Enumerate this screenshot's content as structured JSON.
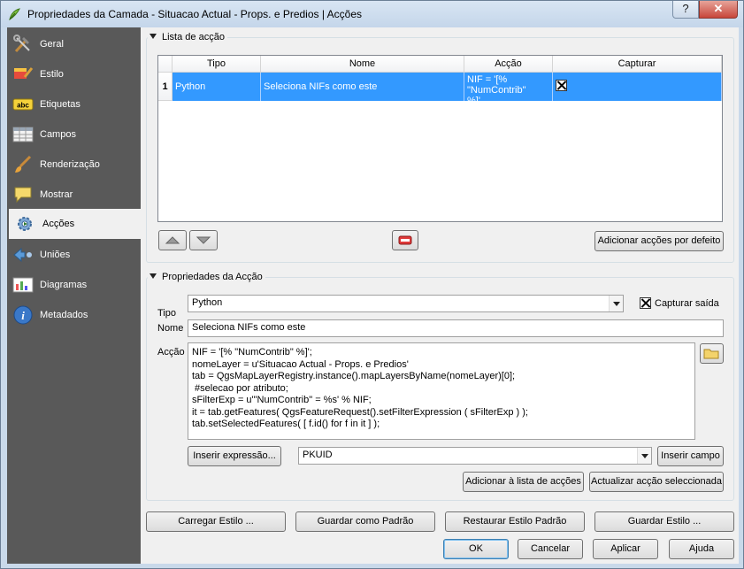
{
  "window": {
    "title": "Propriedades da Camada - Situacao Actual - Props. e Predios | Acções",
    "help": "?",
    "close": "✕"
  },
  "sidebar": {
    "items": [
      {
        "label": "Geral"
      },
      {
        "label": "Estilo"
      },
      {
        "label": "Etiquetas"
      },
      {
        "label": "Campos"
      },
      {
        "label": "Renderização"
      },
      {
        "label": "Mostrar"
      },
      {
        "label": "Acções"
      },
      {
        "label": "Uniões"
      },
      {
        "label": "Diagramas"
      },
      {
        "label": "Metadados"
      }
    ]
  },
  "actions_list": {
    "title": "Lista de acção",
    "columns": [
      "Tipo",
      "Nome",
      "Acção",
      "Capturar"
    ],
    "rows": [
      {
        "index": "1",
        "tipo": "Python",
        "nome": "Seleciona NIFs como este",
        "accao": "NIF = '[% \"NumContrib\" %]'...",
        "capturar": true
      }
    ],
    "default_button": "Adicionar acções por defeito"
  },
  "properties": {
    "title": "Propriedades da Acção",
    "tipo_label": "Tipo",
    "tipo_value": "Python",
    "capture_label": "Capturar saída",
    "capture_checked": true,
    "nome_label": "Nome",
    "nome_value": "Seleciona NIFs como este",
    "accao_label": "Acção",
    "code": "NIF = '[% \"NumContrib\" %]';\nnomeLayer = u'Situacao Actual - Props. e Predios'\ntab = QgsMapLayerRegistry.instance().mapLayersByName(nomeLayer)[0];\n #selecao por atributo;\nsFilterExp = u'\"NumContrib\" = %s' % NIF;\nit = tab.getFeatures( QgsFeatureRequest().setFilterExpression ( sFilterExp ) );\ntab.setSelectedFeatures( [ f.id() for f in it ] );",
    "insert_expression": "Inserir expressão...",
    "field_value": "PKUID",
    "insert_field": "Inserir campo",
    "add_to_list": "Adicionar à lista de acções",
    "update_selected": "Actualizar acção seleccionada"
  },
  "style_buttons": {
    "load": "Carregar Estilo ...",
    "save_default": "Guardar como Padrão",
    "restore_default": "Restaurar Estilo Padrão",
    "save": "Guardar Estilo ..."
  },
  "dialog_buttons": {
    "ok": "OK",
    "cancel": "Cancelar",
    "apply": "Aplicar",
    "help": "Ajuda"
  }
}
